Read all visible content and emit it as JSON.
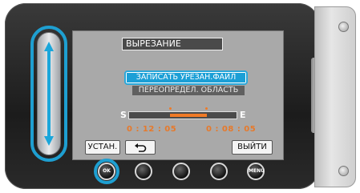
{
  "screen": {
    "title": "ВЫРЕЗАНИЕ",
    "menu": [
      {
        "label": "ЗАПИСАТЬ УРЕЗАН.ФАЙЛ",
        "selected": true
      },
      {
        "label": "ПЕРЕОПРЕДЕЛ. ОБЛАСТЬ",
        "selected": false
      }
    ],
    "trim": {
      "start_marker": "S",
      "end_marker": "E",
      "start_time": "0 : 12 : 05",
      "end_time": "0 : 08 : 05"
    },
    "soft_buttons": {
      "set_label": "УСТАН.",
      "back_icon": "return-arrow-icon",
      "exit_label": "ВЫЙТИ"
    }
  },
  "hardware_buttons": [
    {
      "name": "ok-button",
      "label": "OK"
    },
    {
      "name": "button-2",
      "label": ""
    },
    {
      "name": "button-3",
      "label": ""
    },
    {
      "name": "button-4",
      "label": ""
    },
    {
      "name": "menu-button",
      "label": "MENU"
    }
  ],
  "colors": {
    "highlight": "#1b9fd6",
    "timecode": "#e7792a",
    "screen_bg": "#a9a9a9"
  }
}
